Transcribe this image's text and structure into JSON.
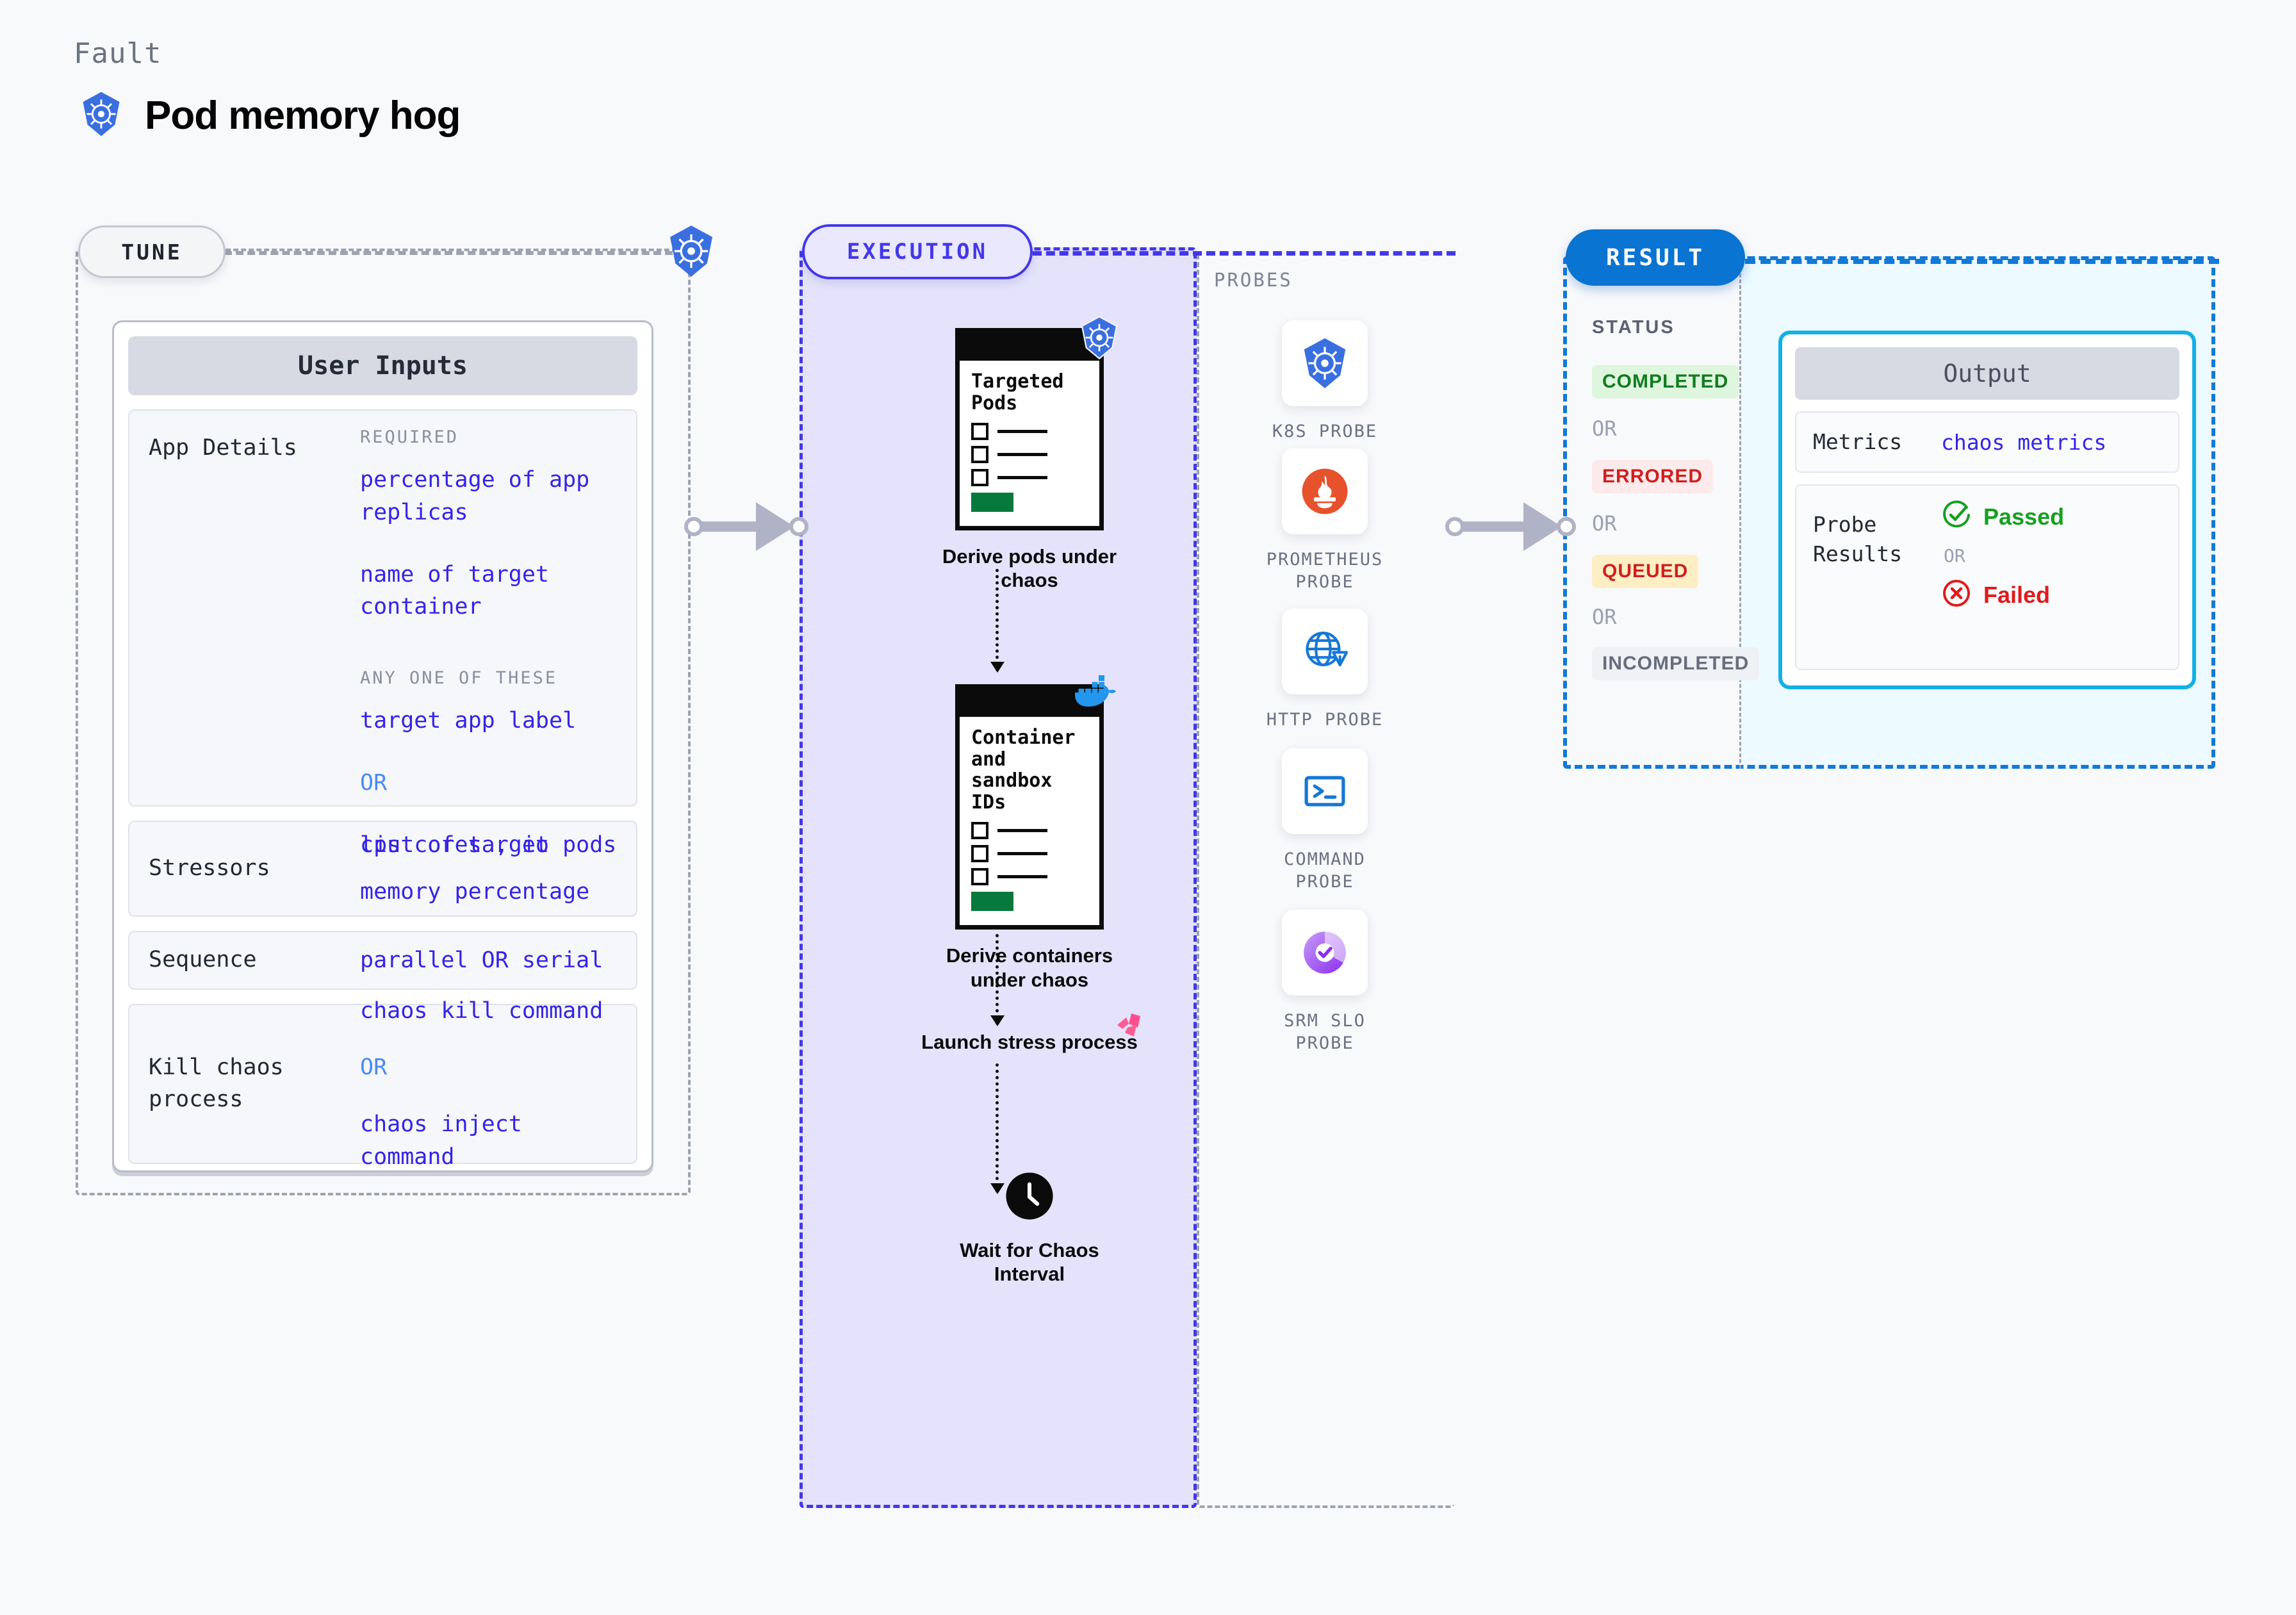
{
  "header": {
    "eyebrow": "Fault",
    "title": "Pod memory hog",
    "icon": "kubernetes-icon"
  },
  "tune": {
    "pill_label": "TUNE",
    "edge_icon": "kubernetes-icon",
    "card_title": "User Inputs",
    "rows": [
      {
        "label": "App Details",
        "groups": [
          {
            "caption": "REQUIRED",
            "values": [
              "percentage of app replicas",
              "name of target container"
            ]
          },
          {
            "caption": "ANY ONE OF THESE",
            "values": [
              "target app label",
              "OR",
              "list of target pods"
            ]
          }
        ]
      },
      {
        "label": "Stressors",
        "values": [
          "cpu cores  , io",
          "memory percentage"
        ]
      },
      {
        "label": "Sequence",
        "values": [
          "parallel OR serial"
        ]
      },
      {
        "label": "Kill chaos process",
        "values": [
          "chaos kill command",
          "OR",
          "chaos inject command"
        ]
      }
    ]
  },
  "execution": {
    "pill_label": "EXECUTION",
    "nodes": [
      {
        "doc_title": "Targeted Pods",
        "caption": "Derive pods under chaos",
        "badge": "kubernetes-icon"
      },
      {
        "doc_title": "Container and sandbox IDs",
        "caption": "Derive containers under chaos",
        "badge": "docker-icon"
      },
      {
        "caption": "Launch stress process",
        "badge": "litmus-icon"
      },
      {
        "caption": "Wait for Chaos Interval",
        "badge": "clock-icon"
      }
    ]
  },
  "probes": {
    "caption": "PROBES",
    "items": [
      {
        "label": "K8S PROBE",
        "icon": "kubernetes-icon"
      },
      {
        "label": "PROMETHEUS PROBE",
        "icon": "prometheus-icon"
      },
      {
        "label": "HTTP PROBE",
        "icon": "http-globe-warning-icon"
      },
      {
        "label": "COMMAND PROBE",
        "icon": "terminal-icon"
      },
      {
        "label": "SRM SLO PROBE",
        "icon": "srm-slo-donut-icon"
      }
    ]
  },
  "result": {
    "pill_label": "RESULT",
    "status_caption": "STATUS",
    "statuses": [
      {
        "label": "COMPLETED",
        "color": "#127c1f",
        "bg": "#def5de"
      },
      {
        "label": "OR",
        "color": "#9aa0b0",
        "bg": "transparent"
      },
      {
        "label": "ERRORED",
        "color": "#cf1f1f",
        "bg": "#fdeaea"
      },
      {
        "label": "OR",
        "color": "#9aa0b0",
        "bg": "transparent"
      },
      {
        "label": "QUEUED",
        "color": "#cf1f1f",
        "bg": "#fdeec3"
      },
      {
        "label": "OR",
        "color": "#9aa0b0",
        "bg": "transparent"
      },
      {
        "label": "INCOMPLETED",
        "color": "#676d7e",
        "bg": "#f0f1f5"
      }
    ],
    "output": {
      "title": "Output",
      "metrics_label": "Metrics",
      "metrics_value": "chaos metrics",
      "probe_results_label": "Probe Results",
      "passed_label": "Passed",
      "or_label": "OR",
      "failed_label": "Failed",
      "passed_color": "#16a020",
      "failed_color": "#e01b1b"
    }
  },
  "colors": {
    "accent_blue": "#3524e8",
    "exec_fill": "#e4e3fb",
    "result_blue": "#0a74d2",
    "output_border": "#13b0e8"
  }
}
